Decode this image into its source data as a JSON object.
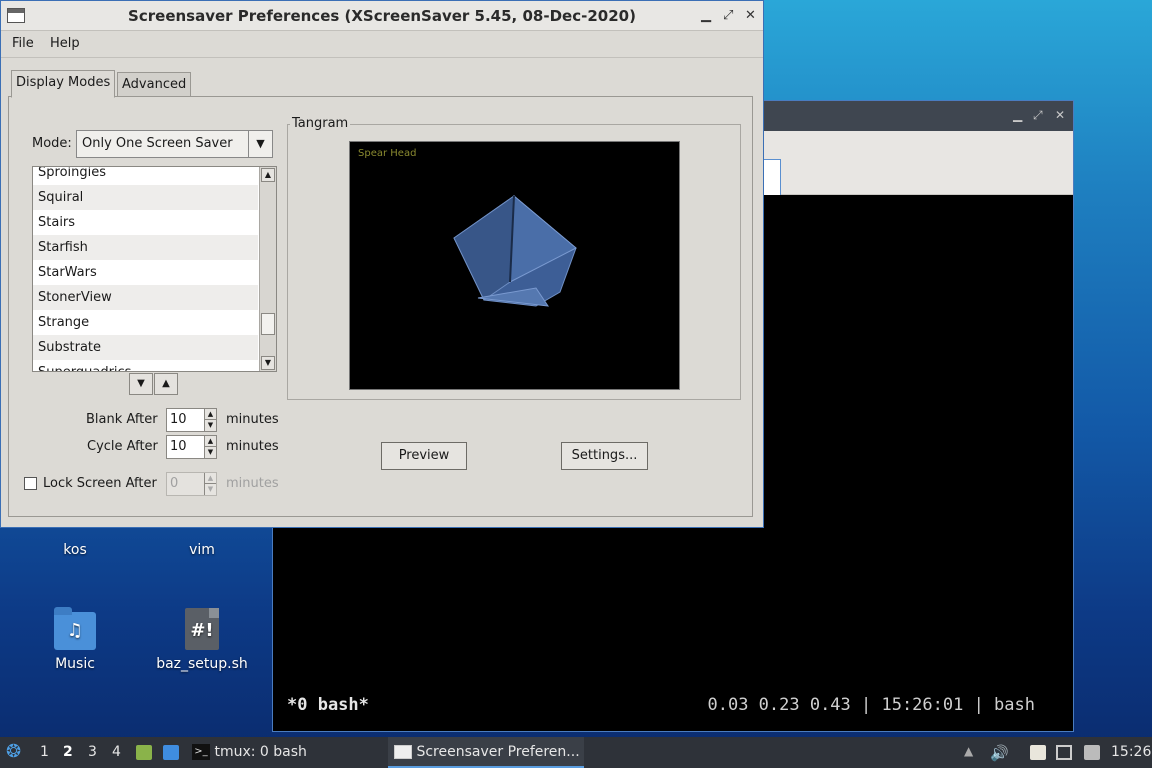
{
  "dialog": {
    "title": "Screensaver Preferences  (XScreenSaver 5.45, 08-Dec-2020)",
    "menu": {
      "file": "File",
      "help": "Help"
    },
    "tabs": [
      {
        "label": "Display Modes",
        "active": true
      },
      {
        "label": "Advanced",
        "active": false
      }
    ],
    "mode": {
      "label": "Mode:",
      "value": "Only One Screen Saver"
    },
    "savers": [
      "Sproingies",
      "Squiral",
      "Stairs",
      "Starfish",
      "StarWars",
      "StonerView",
      "Strange",
      "Substrate",
      "Superquadrics"
    ],
    "blank_after": {
      "label": "Blank After",
      "value": "10",
      "unit": "minutes"
    },
    "cycle_after": {
      "label": "Cycle After",
      "value": "10",
      "unit": "minutes"
    },
    "lock_screen": {
      "label": "Lock Screen After",
      "value": "0",
      "unit": "minutes",
      "checked": false
    },
    "preview_group": {
      "title": "Tangram",
      "caption": "Spear Head"
    },
    "preview_button": "Preview",
    "settings_button": "Settings..."
  },
  "desktop": {
    "icons": [
      {
        "label": "kos"
      },
      {
        "label": "vim"
      },
      {
        "label": "Music",
        "icon": "folder-music-icon"
      },
      {
        "label": "baz_setup.sh",
        "icon": "script-file-icon"
      }
    ]
  },
  "terminal": {
    "status_left": "*0 bash*",
    "status_right": "0.03 0.23 0.43 | 15:26:01 | bash"
  },
  "taskbar": {
    "workspaces": [
      "1",
      "2",
      "3",
      "4"
    ],
    "active_workspace": "2",
    "tasks": [
      {
        "label": "tmux: 0 bash"
      },
      {
        "label": "Screensaver Preferen..."
      }
    ],
    "clock": "15:26"
  }
}
